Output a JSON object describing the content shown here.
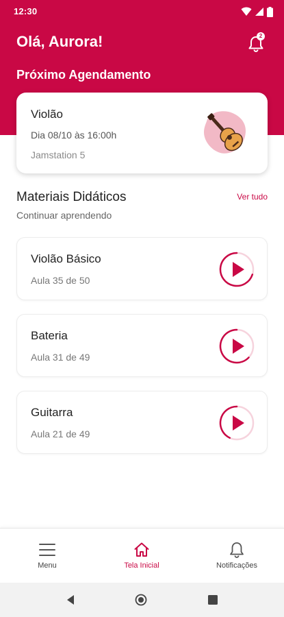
{
  "status_bar": {
    "time": "12:30"
  },
  "header": {
    "greeting": "Olá, Aurora!",
    "notification_count": "2",
    "section_title": "Próximo Agendamento"
  },
  "appointment": {
    "instrument": "Violão",
    "datetime": "Dia 08/10 às 16:00h",
    "location": "Jamstation 5"
  },
  "materials": {
    "title": "Materiais Didáticos",
    "see_all_label": "Ver tudo",
    "subtitle": "Continuar aprendendo",
    "courses": [
      {
        "title": "Violão Básico",
        "progress_text": "Aula 35 de 50",
        "progress": 0.7
      },
      {
        "title": "Bateria",
        "progress_text": "Aula 31 de 49",
        "progress": 0.63
      },
      {
        "title": "Guitarra",
        "progress_text": "Aula 21 de 49",
        "progress": 0.43
      }
    ]
  },
  "bottom_nav": {
    "items": [
      {
        "label": "Menu",
        "icon": "hamburger-menu-icon",
        "active": false
      },
      {
        "label": "Tela Inicial",
        "icon": "home-icon",
        "active": true
      },
      {
        "label": "Notificações",
        "icon": "bell-icon",
        "active": false
      }
    ]
  },
  "colors": {
    "brand": "#c90845",
    "background": "#ffffff",
    "muted_text": "#8a8a8a"
  }
}
